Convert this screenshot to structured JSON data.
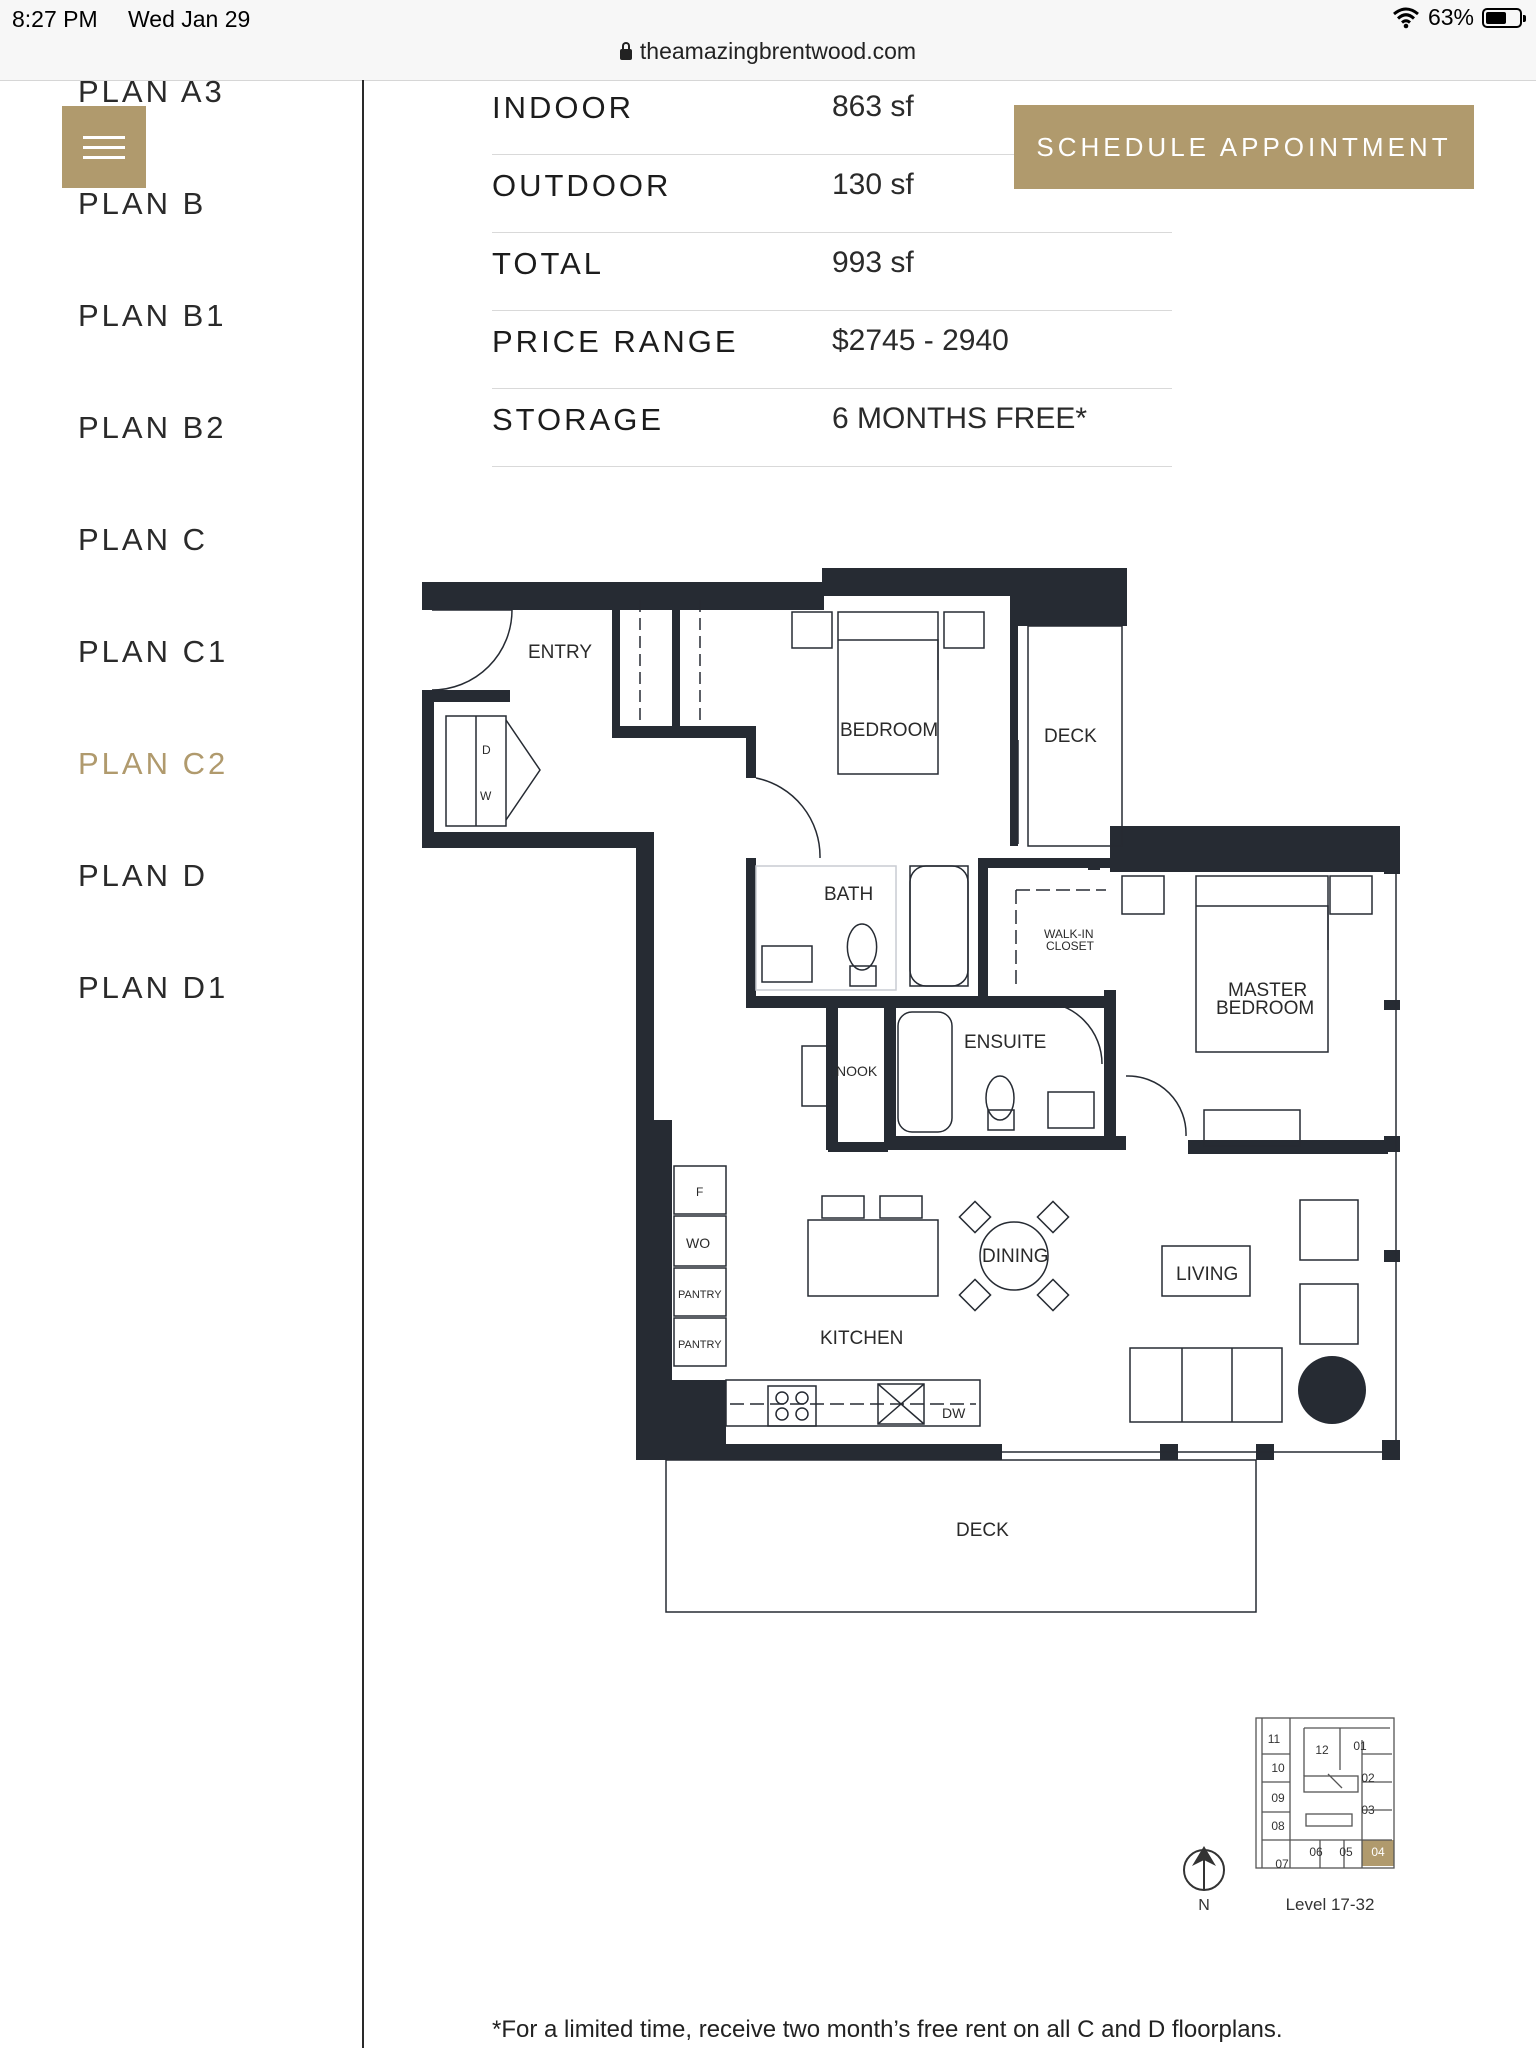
{
  "status_bar": {
    "time": "8:27 PM",
    "date": "Wed Jan 29",
    "battery": "63%",
    "battery_level": 0.63
  },
  "browser": {
    "url": "theamazingbrentwood.com"
  },
  "nav": {
    "items": [
      "PLAN A3",
      "PLAN B",
      "PLAN B1",
      "PLAN B2",
      "PLAN C",
      "PLAN C1",
      "PLAN C2",
      "PLAN D",
      "PLAN D1"
    ],
    "active": "PLAN C2"
  },
  "specs": [
    {
      "label": "INDOOR",
      "value": "863 sf"
    },
    {
      "label": "OUTDOOR",
      "value": "130 sf"
    },
    {
      "label": "TOTAL",
      "value": "993 sf"
    },
    {
      "label": "PRICE RANGE",
      "value": "$2745 - 2940"
    },
    {
      "label": "STORAGE",
      "value": "6 MONTHS FREE*"
    }
  ],
  "schedule_button": "SCHEDULE APPOINTMENT",
  "floorplan": {
    "labels": {
      "entry": "ENTRY",
      "bedroom": "BEDROOM",
      "deck_side": "DECK",
      "bath": "BATH",
      "walkin": "WALK-IN",
      "closet": "CLOSET",
      "master1": "MASTER",
      "master2": "BEDROOM",
      "ensuite": "ENSUITE",
      "nook": "NOOK",
      "f": "F",
      "wo": "WO",
      "pantry1": "PANTRY",
      "pantry2": "PANTRY",
      "dining": "DINING",
      "living": "LIVING",
      "kitchen": "KITCHEN",
      "dw": "DW",
      "deck_main": "DECK",
      "d": "D",
      "w": "W"
    }
  },
  "keyplan": {
    "units": [
      "11",
      "12",
      "01",
      "10",
      "02",
      "09",
      "03",
      "08",
      "07",
      "06",
      "05",
      "04"
    ],
    "highlighted": "04",
    "north": "N",
    "level": "Level 17-32"
  },
  "footnote": "*For a limited time, receive two month’s free rent on all C and D floorplans.",
  "colors": {
    "accent": "#b09a6d",
    "wall": "#262b33",
    "text": "#1c1c1c"
  }
}
